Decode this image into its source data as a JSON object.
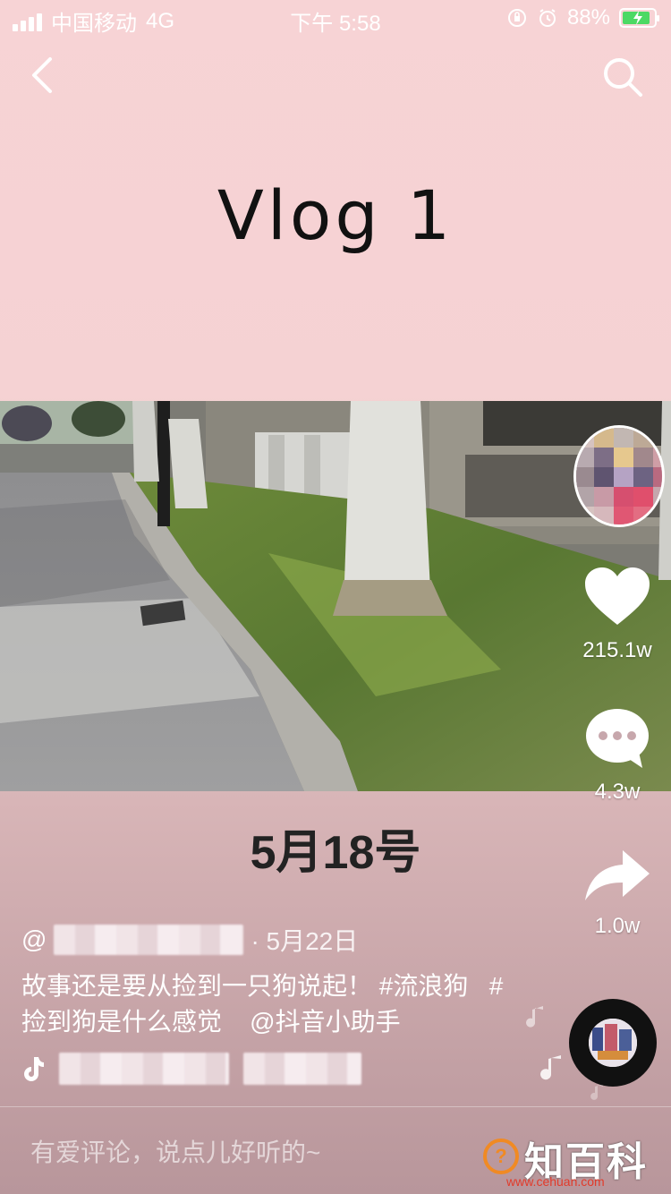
{
  "status_bar": {
    "carrier": "中国移动",
    "network": "4G",
    "time": "下午 5:58",
    "battery": "88%",
    "battery_level": 0.88
  },
  "video": {
    "title_card": "Vlog 1",
    "date_caption": "5月18号"
  },
  "right_rail": {
    "likes": "215.1w",
    "comments": "4.3w",
    "shares": "1.0w"
  },
  "post": {
    "author_prefix": "@",
    "date": "· 5月22日",
    "caption_text": "故事还是要从捡到一只狗说起！ ",
    "tag1": "#流浪狗",
    "tag2": "#捡到狗是什么感觉",
    "mention": "@抖音小助手"
  },
  "comment_bar": {
    "placeholder": "有爱评论，说点儿好听的~"
  },
  "watermark": {
    "icon_char": "?",
    "text": "知百科",
    "url": "www.cehuan.com"
  },
  "colors": {
    "accent_green": "#4cd964",
    "watermark_orange": "#f08a24",
    "watermark_red": "#e23a2a"
  }
}
